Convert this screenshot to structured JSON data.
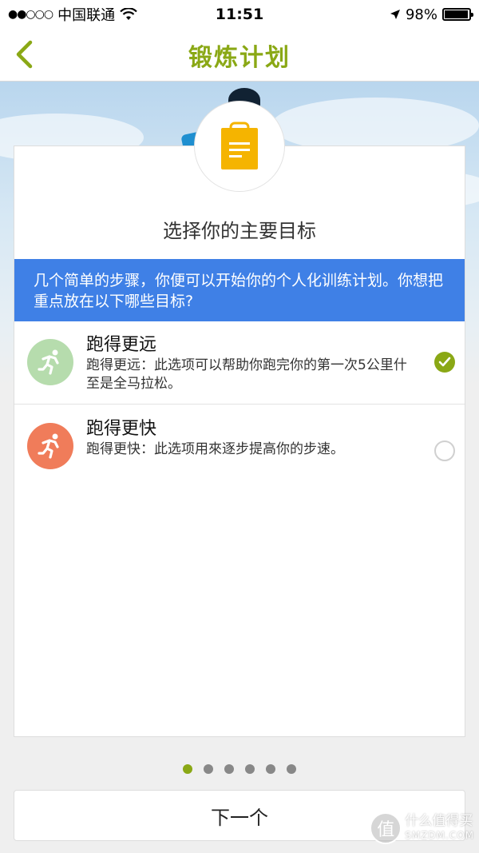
{
  "status_bar": {
    "signal": "●●○○○",
    "carrier": "中国联通",
    "time": "11:51",
    "battery_text": "98%",
    "battery_level": 0.98
  },
  "nav": {
    "title": "锻炼计划",
    "back_icon": "chevron-left-icon"
  },
  "card": {
    "title": "选择你的主要目标",
    "intro": "几个简单的步骤，你便可以开始你的个人化训练计划。你想把重点放在以下哪些目标?",
    "options": [
      {
        "title": "跑得更远",
        "description": "跑得更远：此选项可以帮助你跑完你的第一次5公里什至是全马拉松。",
        "icon_color": "#b6dcad",
        "selected": true
      },
      {
        "title": "跑得更快",
        "description": "跑得更快：此选项用來逐步提高你的步速。",
        "icon_color": "#f07c5a",
        "selected": false
      }
    ]
  },
  "pager": {
    "total": 6,
    "current": 1
  },
  "next_button": {
    "label": "下一个"
  },
  "watermark": {
    "cn": "什么值得买",
    "en": "SMZDM.COM",
    "logo_char": "值"
  },
  "colors": {
    "accent": "#8aa815",
    "banner": "#3f80e6",
    "clipboard": "#f5b400"
  }
}
